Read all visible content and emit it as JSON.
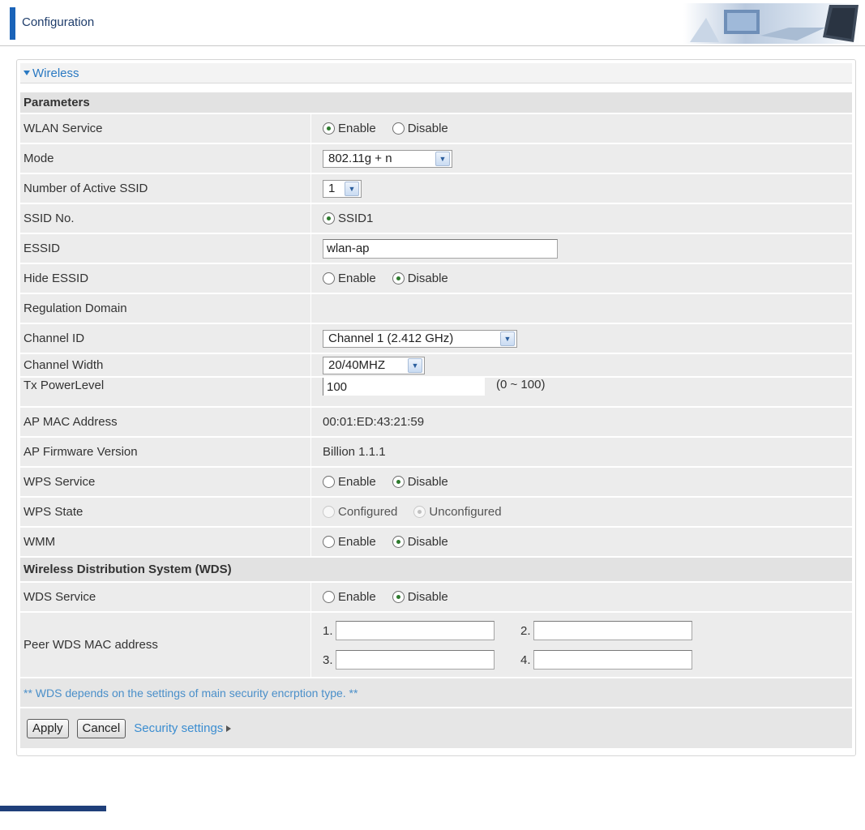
{
  "header": {
    "title": "Configuration",
    "accent_color": "#1a63b8"
  },
  "wireless": {
    "title": "Wireless"
  },
  "parameters": {
    "section_label": "Parameters",
    "wlan_service": {
      "label": "WLAN Service",
      "enable": "Enable",
      "disable": "Disable",
      "selected": "Enable"
    },
    "mode": {
      "label": "Mode",
      "value": "802.11g + n"
    },
    "active_ssid": {
      "label": "Number of Active SSID",
      "value": "1"
    },
    "ssid_no": {
      "label": "SSID No.",
      "option": "SSID1"
    },
    "essid": {
      "label": "ESSID",
      "value": "wlan-ap"
    },
    "hide_essid": {
      "label": "Hide ESSID",
      "enable": "Enable",
      "disable": "Disable",
      "selected": "Disable"
    },
    "regulation_domain": {
      "label": "Regulation Domain"
    },
    "channel_id": {
      "label": "Channel ID",
      "value": "Channel 1 (2.412 GHz)"
    },
    "channel_width": {
      "label": "Channel Width",
      "value": "20/40MHZ"
    },
    "tx_power": {
      "label": "Tx PowerLevel",
      "value": "100",
      "range": "(0 ~ 100)"
    },
    "ap_mac": {
      "label": "AP MAC Address",
      "value": "00:01:ED:43:21:59"
    },
    "ap_firmware": {
      "label": "AP Firmware Version",
      "value": "Billion 1.1.1"
    },
    "wps_service": {
      "label": "WPS Service",
      "enable": "Enable",
      "disable": "Disable",
      "selected": "Disable"
    },
    "wps_state": {
      "label": "WPS State",
      "configured": "Configured",
      "unconfigured": "Unconfigured",
      "selected": "Unconfigured"
    },
    "wmm": {
      "label": "WMM",
      "enable": "Enable",
      "disable": "Disable",
      "selected": "Disable"
    }
  },
  "wds": {
    "section_label": "Wireless Distribution System (WDS)",
    "service": {
      "label": "WDS Service",
      "enable": "Enable",
      "disable": "Disable",
      "selected": "Disable"
    },
    "peer": {
      "label": "Peer WDS MAC address",
      "items": [
        {
          "num": "1.",
          "value": ""
        },
        {
          "num": "2.",
          "value": ""
        },
        {
          "num": "3.",
          "value": ""
        },
        {
          "num": "4.",
          "value": ""
        }
      ]
    },
    "notice": "** WDS depends on the settings of main security encrption type. **"
  },
  "actions": {
    "apply": "Apply",
    "cancel": "Cancel",
    "security_link": "Security settings"
  }
}
